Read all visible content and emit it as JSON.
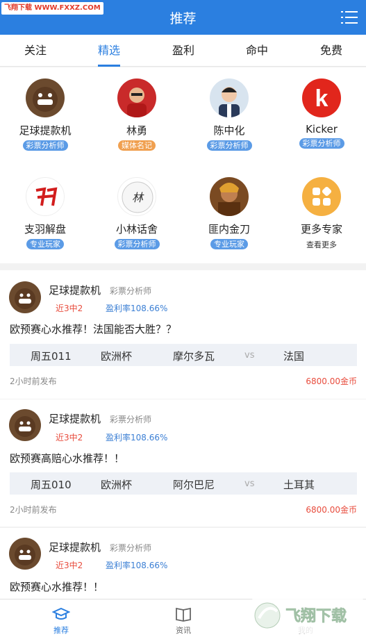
{
  "watermark_top": "飞翔下载 WWW.FXXZ.COM",
  "header": {
    "title": "推荐"
  },
  "tabs": [
    "关注",
    "精选",
    "盈利",
    "命中",
    "免费"
  ],
  "active_tab": "精选",
  "experts": [
    {
      "name": "足球提款机",
      "tag": "彩票分析师"
    },
    {
      "name": "林勇",
      "tag": "媒体名记"
    },
    {
      "name": "陈中化",
      "tag": "彩票分析师"
    },
    {
      "name": "Kicker",
      "tag": "彩票分析师"
    },
    {
      "name": "支羽解盘",
      "tag": "专业玩家"
    },
    {
      "name": "小林话舍",
      "tag": "彩票分析师"
    },
    {
      "name": "匪内金刀",
      "tag": "专业玩家"
    },
    {
      "name": "更多专家",
      "more": "查看更多"
    }
  ],
  "posts": [
    {
      "user": "足球提款机",
      "role": "彩票分析师",
      "recent": "近3中2",
      "profit": "盈利率108.66%",
      "text": "欧预赛心水推荐！法国能否大胜？？",
      "match": {
        "id": "周五011",
        "league": "欧洲杯",
        "home": "摩尔多瓦",
        "vs": "vs",
        "away": "法国"
      },
      "time": "2小时前发布",
      "price": "6800.00金币"
    },
    {
      "user": "足球提款机",
      "role": "彩票分析师",
      "recent": "近3中2",
      "profit": "盈利率108.66%",
      "text": "欧预赛高赔心水推荐！！",
      "match": {
        "id": "周五010",
        "league": "欧洲杯",
        "home": "阿尔巴尼",
        "vs": "vs",
        "away": "土耳其"
      },
      "time": "2小时前发布",
      "price": "6800.00金币"
    },
    {
      "user": "足球提款机",
      "role": "彩票分析师",
      "recent": "近3中2",
      "profit": "盈利率108.66%",
      "text": "欧预赛心水推荐！！"
    }
  ],
  "bottom_nav": [
    {
      "label": "推荐",
      "icon": "graduation-cap-icon"
    },
    {
      "label": "资讯",
      "icon": "book-icon"
    },
    {
      "label": "我的",
      "icon": "user-icon"
    }
  ],
  "colors": {
    "primary": "#2b7fe0",
    "accent_red": "#e84c3d",
    "tag_blue": "#5b9be6",
    "tag_orange": "#f0a050"
  }
}
